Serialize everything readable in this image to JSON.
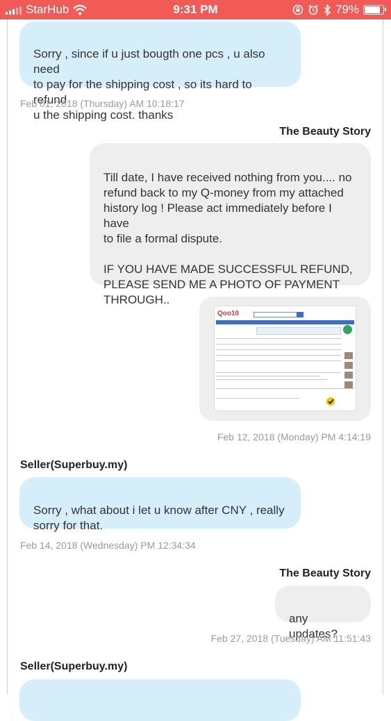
{
  "status_bar": {
    "carrier": "StarHub",
    "time": "9:31 PM",
    "battery": "79%",
    "battery_level": 0.79,
    "icons": [
      "signal-icon",
      "wifi-icon",
      "lock-rotation-icon",
      "alarm-icon",
      "bluetooth-icon",
      "battery-icon"
    ]
  },
  "messages": [
    {
      "text": "Sorry , since if u just bougth one pcs , u also need\nto pay for the shipping cost , so its hard to refund\nu the shipping cost. thanks",
      "timestamp": "Feb 01, 2018 (Thursday) AM 10:18:17"
    },
    {
      "sender": "The Beauty Story",
      "text": "Till date, I have received nothing from you.... no\nrefund back to my Q-money from my attached\nhistory log ! Please act immediately before I have\nto file a formal dispute.\n\nIF YOU HAVE MADE SUCCESSFUL REFUND,\nPLEASE SEND ME A PHOTO OF PAYMENT\nTHROUGH.."
    },
    {
      "type": "image",
      "timestamp": "Feb 12, 2018 (Monday) PM 4:14:19",
      "image_logo": "Qoo10"
    },
    {
      "sender": "Seller(Superbuy.my)",
      "text": "Sorry , what about i let u know after CNY , really\nsorry for that.",
      "timestamp": "Feb 14, 2018 (Wednesday) PM 12:34:34"
    },
    {
      "sender": "The Beauty Story",
      "text": "any updates?",
      "timestamp": "Feb 27, 2018 (Tuesday) AM 11:51:43"
    },
    {
      "sender": "Seller(Superbuy.my)"
    }
  ],
  "colors": {
    "status_bar": "#f25a56",
    "incoming_bubble": "#d6edfa",
    "outgoing_bubble": "#eeeeee",
    "timestamp": "#9a9a9a"
  }
}
